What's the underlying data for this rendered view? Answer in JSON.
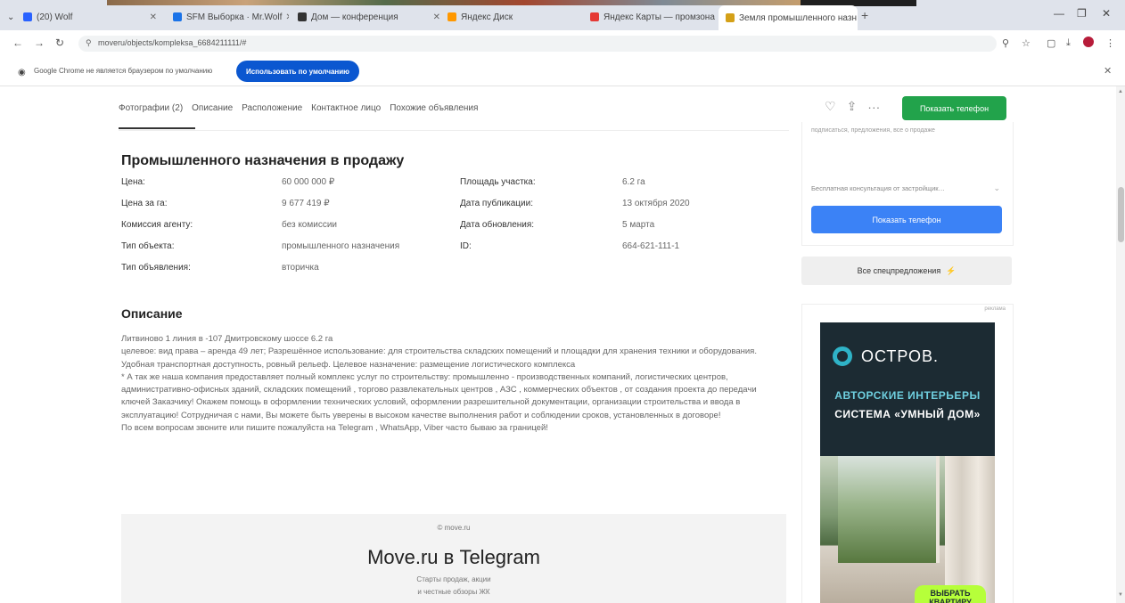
{
  "browser": {
    "tabs": [
      {
        "title": "(20) Wolf ",
        "color": "#2962ff"
      },
      {
        "title": "SFM Выборка · Mr.Wolf",
        "color": "#1a73e8"
      },
      {
        "title": "Дом — конференция",
        "color": "#333333"
      },
      {
        "title": "Яндекс Диск",
        "color": "#ff9800"
      },
      {
        "title": "Яндекс Карты — промзона",
        "color": "#e53935"
      },
      {
        "title": "Земля промышленного назн…",
        "color": "#d4a017"
      }
    ],
    "active_tab_index": 5,
    "new_tab": "+",
    "url": "moveru/objects/kompleksa_6684211111/#",
    "info_message": "Google Chrome не является браузером по умолчанию",
    "info_button": "Использовать по умолчанию"
  },
  "subnav": {
    "items": [
      "Фотографии (2)",
      "Описание",
      "Расположение",
      "Контактное лицо",
      "Похожие объявления"
    ]
  },
  "header_actions": {
    "show_phone": "Показать телефон"
  },
  "params": {
    "title": "Промышленного назначения в продажу",
    "rows": [
      {
        "label": "Цена:",
        "value": "60 000 000 ₽",
        "label2": "Площадь участка:",
        "value2": "6.2 га"
      },
      {
        "label": "Цена за га:",
        "value": "9 677 419 ₽",
        "label2": "Дата публикации:",
        "value2": "13 октября 2020"
      },
      {
        "label": "Комиссия агенту:",
        "value": "без комиссии",
        "label2": "Дата обновления:",
        "value2": "5 марта"
      },
      {
        "label": "Тип объекта:",
        "value": "промышленного назначения",
        "label2": "ID:",
        "value2": "664-621-111-1"
      },
      {
        "label": "Тип объявления:",
        "value": "вторичка",
        "label2": "",
        "value2": ""
      }
    ]
  },
  "description": {
    "title": "Описание",
    "paragraphs": [
      "Литвиново 1 линия в -107 Дмитровскому шоссе 6.2 га",
      "целевое: вид права – аренда 49 лет; Разрешённое использование: для строительства складских помещений и площадки для хранения техники и оборудования. Удобная транспортная доступность, ровный рельеф. Целевое назначение: размещение логистического комплекса",
      "* А так же наша компания предоставляет полный комплекс услуг по строительству: промышленно - производственных компаний, логистических центров, административно-офисных зданий, складских помещений , торгово развлекательных центров , АЗС , коммерческих объектов , от создания проекта до передачи ключей Заказчику! Окажем помощь в оформлении технических условий, оформлении разрешительной документации, организации строительства и ввода в эксплуатацию! Сотрудничая с нами, Вы можете быть уверены в высоком качестве выполнения работ и соблюдении сроков, установленных в договоре!",
      "По всем вопросам звоните или пишите пожалуйста на Telegram , WhatsApp, Viber часто бываю за границей!"
    ]
  },
  "telegram_block": {
    "source": "© move.ru",
    "title": "Move.ru в Telegram",
    "line1": "Старты продаж, акции",
    "line2": "и честные обзоры ЖК"
  },
  "sidebar": {
    "faint_text": "подписаться, предложения, все о продаже",
    "dropdown": "Бесплатная консультация от застройщик…",
    "show_phone_blue": "Показать телефон",
    "special_offers": "Все спецпредложения"
  },
  "ad": {
    "label": "реклама",
    "brand": "ОСТРОВ.",
    "line1": "АВТОРСКИЕ ИНТЕРЬЕРЫ",
    "line2": "СИСТЕМА «УМНЫЙ ДОМ»",
    "cta": "ВЫБРАТЬ КВАРТИРУ",
    "accent": "#b6ff3a"
  }
}
